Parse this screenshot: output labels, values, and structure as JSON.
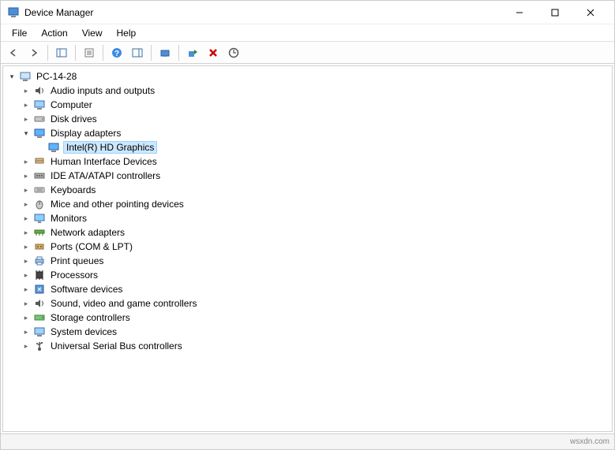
{
  "window": {
    "title": "Device Manager"
  },
  "menu": {
    "file": "File",
    "action": "Action",
    "view": "View",
    "help": "Help"
  },
  "tree": {
    "root": "PC-14-28",
    "audio": "Audio inputs and outputs",
    "computer": "Computer",
    "disk": "Disk drives",
    "display": "Display adapters",
    "display_child": "Intel(R) HD Graphics",
    "hid": "Human Interface Devices",
    "ide": "IDE ATA/ATAPI controllers",
    "keyboards": "Keyboards",
    "mice": "Mice and other pointing devices",
    "monitors": "Monitors",
    "network": "Network adapters",
    "ports": "Ports (COM & LPT)",
    "print": "Print queues",
    "processors": "Processors",
    "software": "Software devices",
    "sound": "Sound, video and game controllers",
    "storage": "Storage controllers",
    "system": "System devices",
    "usb": "Universal Serial Bus controllers"
  },
  "status": {
    "watermark": "wsxdn.com"
  }
}
